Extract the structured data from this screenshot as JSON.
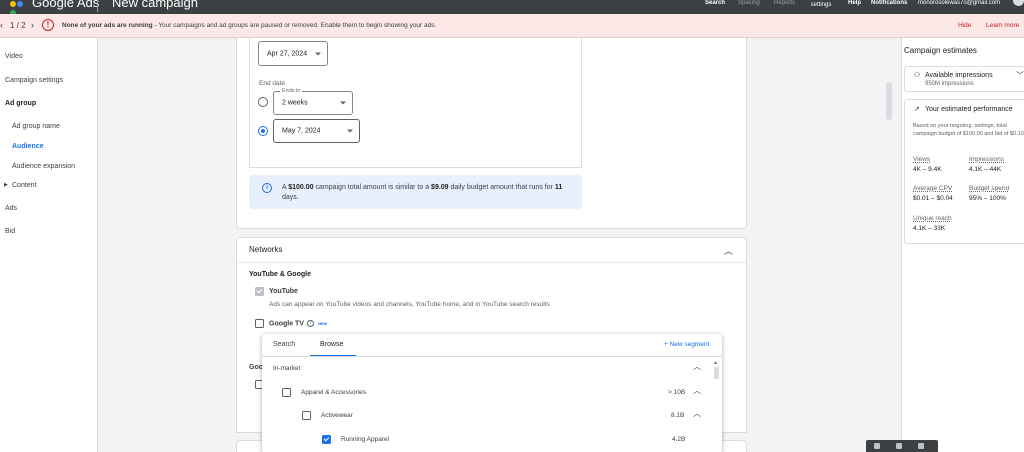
{
  "header": {
    "brand": "Google Ads",
    "campaign": "New campaign",
    "logo_colors": [
      "#fbbc04",
      "#4285f4",
      "#34a853"
    ],
    "nav": [
      "Search",
      "Spacing",
      "Reports",
      "Tools and settings",
      "Help",
      "Notifications"
    ],
    "account": "monorosolewas7o@gmail.com"
  },
  "banner": {
    "pager": "1 / 2",
    "bold": "None of your ads are running",
    "message": " - Your campaigns and ad groups are paused or removed. Enable them to begin showing your ads.",
    "hide": "Hide",
    "learn_more": "Learn more",
    "color": "#c5221f"
  },
  "sidebar": {
    "items": [
      {
        "label": "Video"
      },
      {
        "label": "Campaign settings"
      },
      {
        "label": "Ad group"
      },
      {
        "label": "Ad group name"
      },
      {
        "label": "Audience"
      },
      {
        "label": "Audience expansion"
      },
      {
        "label": "Content"
      },
      {
        "label": "Ads"
      },
      {
        "label": "Bid"
      }
    ]
  },
  "dates": {
    "start_value": "Apr 27, 2024",
    "end_label": "End date",
    "ends_in_legend": "Ends in",
    "ends_in_value": "2 weeks",
    "end_date_value": "May 7, 2024"
  },
  "info": {
    "prefix": "A ",
    "total": "$100.00",
    "mid": " campaign total amount is similar to a ",
    "daily": "$9.09",
    "mid2": " daily budget amount that runs for ",
    "days": "11",
    "suffix": " days."
  },
  "networks": {
    "title": "Networks",
    "group": "YouTube & Google",
    "youtube_label": "YouTube",
    "youtube_desc": "Ads can appear on YouTube videos and channels, YouTube home, and in YouTube search results",
    "googletv_label": "Google TV",
    "new_badge": "NEW",
    "partial": "Goo"
  },
  "segment_popup": {
    "tabs": [
      "Search",
      "Browse"
    ],
    "new_segment": "+ New segment",
    "section": "In-market",
    "rows": [
      {
        "label": "Apparel & Accessories",
        "count": "> 10B"
      },
      {
        "label": "Activewear",
        "count": "8.1B"
      },
      {
        "label": "Running Apparel",
        "count": "4.2B"
      }
    ]
  },
  "estimates": {
    "title": "Campaign estimates",
    "available_title": "Available impressions",
    "available_value": "950M impressions",
    "performance_title": "Your estimated performance",
    "performance_desc": "Based on your targeting, settings, total campaign budget of $100.00 and bid of $0.10",
    "metrics": [
      {
        "k": "Views",
        "v": "4K – 9.4K"
      },
      {
        "k": "Impressions",
        "v": "4.1K – 44K"
      },
      {
        "k": "Average CPV",
        "v": "$0.01 – $0.04"
      },
      {
        "k": "Budget spend",
        "v": "95% – 100%"
      },
      {
        "k": "Unique reach",
        "v": "4.1K – 33K"
      }
    ]
  }
}
